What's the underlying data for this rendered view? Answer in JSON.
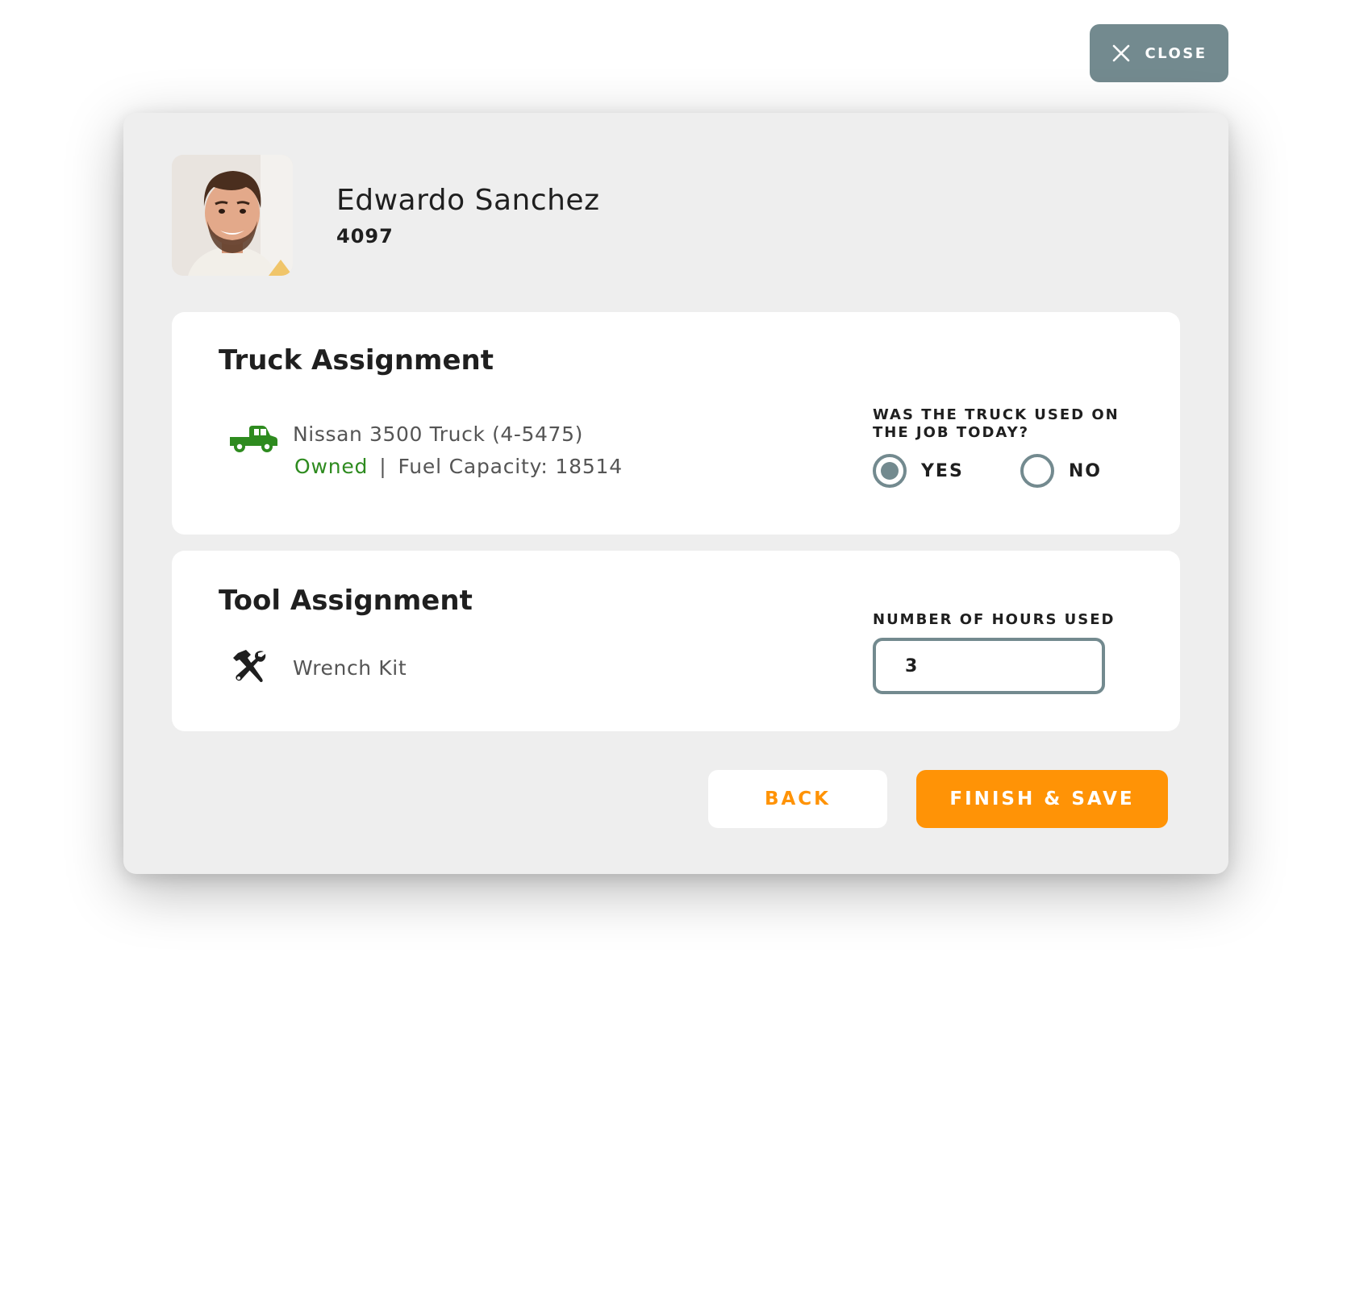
{
  "close": {
    "label": "CLOSE",
    "icon": "close-icon"
  },
  "employee": {
    "name": "Edwardo Sanchez",
    "id": "4097"
  },
  "truck_assignment": {
    "title": "Truck Assignment",
    "icon": "truck-icon",
    "vehicle": "Nissan 3500 Truck (4-5475)",
    "ownership": "Owned",
    "separator": "|",
    "fuel_capacity": "Fuel Capacity: 18514",
    "question": "WAS THE TRUCK USED ON THE JOB TODAY?",
    "options": [
      {
        "label": "YES",
        "selected": true
      },
      {
        "label": "NO",
        "selected": false
      }
    ]
  },
  "tool_assignment": {
    "title": "Tool Assignment",
    "icon": "hammer-wrench-icon",
    "tool": "Wrench Kit",
    "hours_label": "NUMBER OF HOURS USED",
    "hours_value": "3"
  },
  "actions": {
    "back": "BACK",
    "finish": "FINISH & SAVE"
  },
  "colors": {
    "accent": "#ff9306",
    "slate": "#738a8f",
    "owned_green": "#2e8b1f",
    "modal_bg": "#eeeeee"
  }
}
